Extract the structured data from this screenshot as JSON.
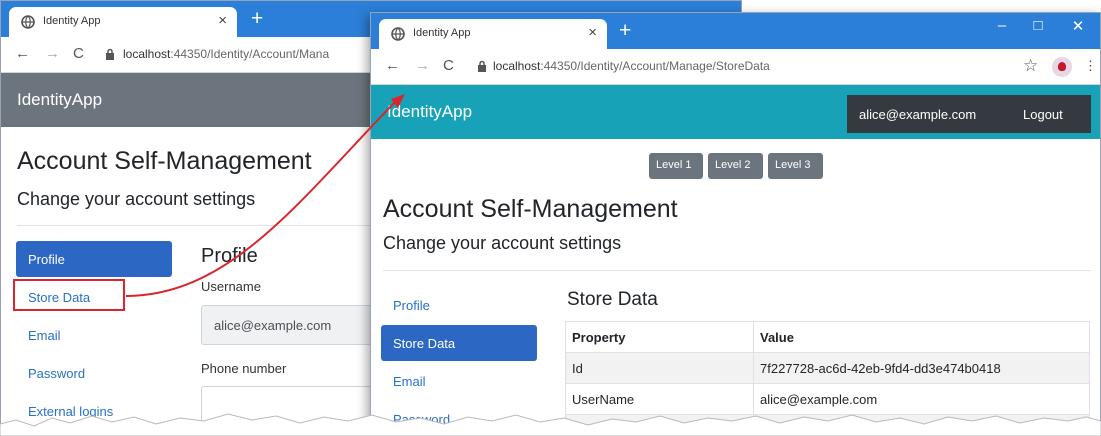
{
  "colors": {
    "chrome_tab_bar": "#2c7fd8",
    "back_navbar": "#6c757d",
    "front_navbar": "#17a2b8",
    "active_nav": "#2d67c4",
    "link": "#2770c8",
    "callout_red": "#d9262c"
  },
  "back_window": {
    "tab_title": "Identity App",
    "url_host": "localhost",
    "url_path": ":44350/Identity/Account/Mana",
    "brand": "IdentityApp",
    "page_title": "Account Self-Management",
    "subtitle": "Change your account settings",
    "nav": [
      {
        "label": "Profile",
        "active": true
      },
      {
        "label": "Store Data",
        "active": false,
        "highlighted": true
      },
      {
        "label": "Email",
        "active": false
      },
      {
        "label": "Password",
        "active": false
      },
      {
        "label": "External logins",
        "active": false
      }
    ],
    "section_title": "Profile",
    "username_label": "Username",
    "username_value": "alice@example.com",
    "phone_label": "Phone number"
  },
  "front_window": {
    "tab_title": "Identity App",
    "url_host": "localhost",
    "url_path": ":44350/Identity/Account/Manage/StoreData",
    "brand": "IdentityApp",
    "user_email": "alice@example.com",
    "logout_label": "Logout",
    "level_buttons": [
      "Level 1",
      "Level 2",
      "Level 3"
    ],
    "page_title": "Account Self-Management",
    "subtitle": "Change your account settings",
    "nav": [
      {
        "label": "Profile",
        "active": false
      },
      {
        "label": "Store Data",
        "active": true
      },
      {
        "label": "Email",
        "active": false
      },
      {
        "label": "Password",
        "active": false
      }
    ],
    "section_title": "Store Data",
    "table": {
      "headers": [
        "Property",
        "Value"
      ],
      "rows": [
        [
          "Id",
          "7f227728-ac6d-42eb-9fd4-dd3e474b0418"
        ],
        [
          "UserName",
          "alice@example.com"
        ],
        [
          "",
          "ALICE@"
        ]
      ]
    }
  }
}
